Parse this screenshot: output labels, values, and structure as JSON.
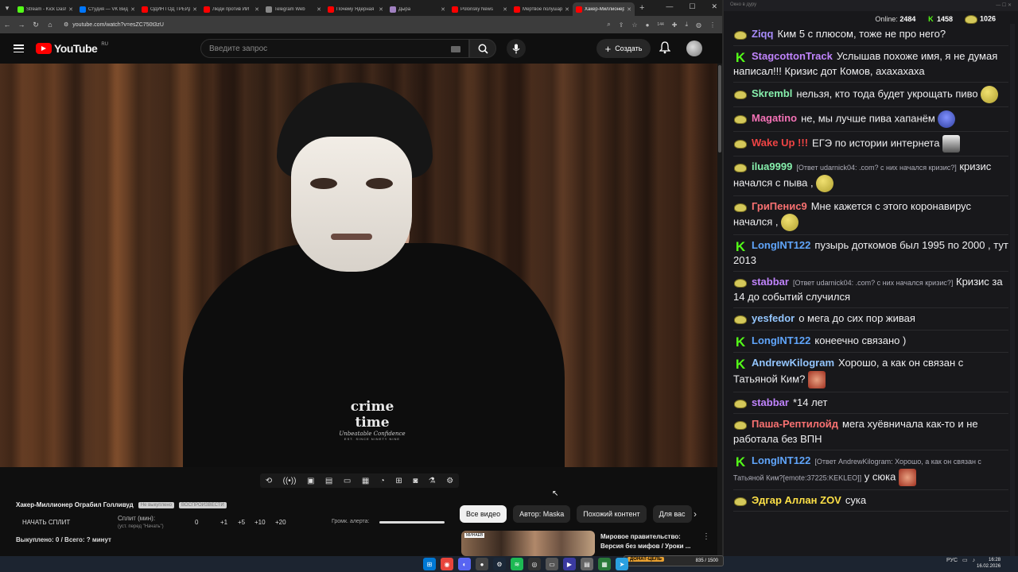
{
  "browser": {
    "tabs": [
      {
        "label": "Stream - Kick Dashboard",
        "color": "#53fc18"
      },
      {
        "label": "Студия — VK Видео",
        "color": "#0077ff"
      },
      {
        "label": "ОДИН ГОД ТРЕЙДИНГА",
        "color": "#ff0000"
      },
      {
        "label": "Люди против ИИ",
        "color": "#ff0000"
      },
      {
        "label": "Telegram Web",
        "color": "#888888"
      },
      {
        "label": "Почему Ядерная",
        "color": "#ff0000"
      },
      {
        "label": "Дыра",
        "color": "#a080c0"
      },
      {
        "label": "Polonsky News",
        "color": "#ff0000"
      },
      {
        "label": "Мертвое полушарие",
        "color": "#ff0000"
      },
      {
        "label": "Хакер-Миллионер",
        "color": "#ff0000",
        "active": true
      }
    ],
    "url": "youtube.com/watch?v=esZC750t3zU",
    "ext_badge": "144"
  },
  "youtube": {
    "logo_text": "YouTube",
    "region": "RU",
    "search_placeholder": "Введите запрос",
    "create_label": "Создать",
    "shirt_text_1": "crime time",
    "shirt_text_2": "Unbeatable Confidence",
    "shirt_text_3": "EST. SINCE NINETY NINE"
  },
  "overlay": {
    "video_title": "Хакер-Миллионер Ограбил Голливуд",
    "pill1": "Не выкуплено",
    "pill2": "ВОСПРОИЗВЕСТИ",
    "start_split": "НАЧАТЬ СПЛИТ",
    "split_min": "Сплит (мин):",
    "split_sub": "(уст. перед \"Начать\")",
    "split_value": "0",
    "increments": [
      "+1",
      "+5",
      "+10",
      "+20"
    ],
    "volume_label": "Громк. алерта:",
    "bought_line": "Выкуплено: 0 / Всего: ? минут"
  },
  "chips": [
    "Все видео",
    "Автор: Maska",
    "Похожий контент",
    "Для вас"
  ],
  "reco": {
    "thumb_label": "МИНАЕВ",
    "title_line1": "Мировое правительство:",
    "title_line2": "Версия без мифов / Уроки ..."
  },
  "chat": {
    "window_title": "Окно в дуру",
    "online_label": "Online:",
    "online_count": "2484",
    "kick_count": "1458",
    "pepe_count": "1026",
    "messages": [
      {
        "badge": "pepe",
        "user": "Ziqq",
        "color": "#a78bfa",
        "text": "Ким 5 с плюсом, тоже не про него?"
      },
      {
        "badge": "kick",
        "user": "StagcottonTrack",
        "color": "#c084fc",
        "text": "Услышав похоже имя, я не думая написал!!! Кризис дот Комов, ахахахаха"
      },
      {
        "badge": "pepe",
        "user": "Skrembl",
        "color": "#86efac",
        "text": "нельзя, кто тода будет укрощать пиво"
      },
      {
        "badge": "pepe",
        "user": "Magatino",
        "color": "#f472b6",
        "text": "не, мы лучше пива хапанём"
      },
      {
        "badge": "pepe",
        "user": "Wake Up !!!",
        "color": "#ef4444",
        "text": "ЕГЭ по истории интернета"
      },
      {
        "badge": "pepe",
        "user": "ilua9999",
        "color": "#86efac",
        "reply": "[Ответ udarnick04: .com? с них начался кризис?]",
        "text": "кризис начался с пыва ,"
      },
      {
        "badge": "pepe",
        "user": "ГриПенис9",
        "color": "#f87171",
        "text": "Мне кажется с этого коронавирус начался ,"
      },
      {
        "badge": "kick",
        "user": "LongINT122",
        "color": "#60a5fa",
        "text": "пузырь доткомов был 1995 по 2000 , тут 2013"
      },
      {
        "badge": "pepe",
        "user": "stabbar",
        "color": "#c084fc",
        "reply": "[Ответ udarnick04: .com? с них начался кризис?]",
        "text": "Кризис за 14 до событий случился"
      },
      {
        "badge": "pepe",
        "user": "yesfedor",
        "color": "#93c5fd",
        "text": "о мега до сих пор живая"
      },
      {
        "badge": "kick",
        "user": "LongINT122",
        "color": "#60a5fa",
        "text": "конеечно связано )"
      },
      {
        "badge": "kick",
        "user": "AndrewKilogram",
        "color": "#93c5fd",
        "text": "Хорошо, а как он связан с Татьяной Ким?"
      },
      {
        "badge": "pepe",
        "user": "stabbar",
        "color": "#c084fc",
        "text": "*14 лет"
      },
      {
        "badge": "pepe",
        "user": "Паша-Рептилойд",
        "color": "#f87171",
        "text": "мега хуёвничала как-то и не работала без ВПН"
      },
      {
        "badge": "kick",
        "user": "LongINT122",
        "color": "#60a5fa",
        "reply": "[Ответ AndrewKilogram: Хорошо, а как он связан с Татьяной Ким?[emote:37225:KEKLEO]]",
        "text": "у сюка"
      },
      {
        "badge": "pepe",
        "user": "Эдгар Аллан ZOV",
        "color": "#fde047",
        "text": "сука"
      }
    ]
  },
  "taskbar": {
    "lang": "РУС",
    "time": "16:28",
    "date": "16.02.2026",
    "widget_label": "ДОНАТ-ЦЕЛЬ",
    "widget_value": "835 / 1500"
  }
}
